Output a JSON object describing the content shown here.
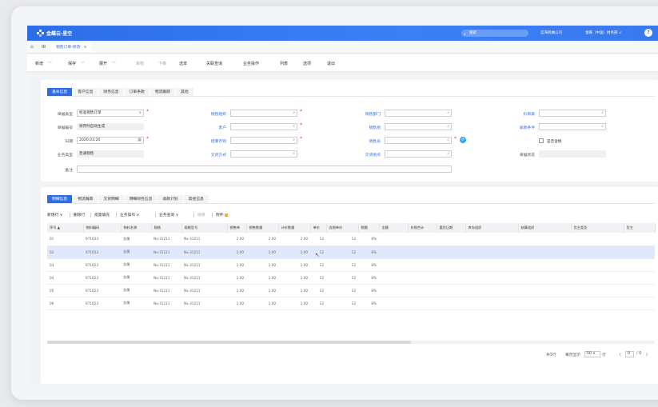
{
  "topbar": {
    "logo": "金蝶云·星空",
    "search_placeholder": "搜索",
    "company": "蓝海机械公司",
    "user": "金蝶（中国）财务部 ∨",
    "help": "?"
  },
  "tab": {
    "title": "销售订单-修改",
    "close": "⊗"
  },
  "toolbar": [
    {
      "label": "新增",
      "chev": true,
      "disabled": false
    },
    {
      "label": "保存",
      "chev": true,
      "disabled": false
    },
    {
      "label": "展开",
      "chev": true,
      "disabled": false
    },
    {
      "label": "审核",
      "chev": false,
      "disabled": true
    },
    {
      "label": "下推",
      "chev": false,
      "disabled": true
    },
    {
      "label": "选单",
      "chev": false,
      "disabled": false
    },
    {
      "label": "关联查询",
      "chev": false,
      "disabled": false
    },
    {
      "label": "业务操作",
      "chev": false,
      "disabled": false
    },
    {
      "label": "列表",
      "chev": false,
      "disabled": false
    },
    {
      "label": "选项",
      "chev": false,
      "disabled": false
    },
    {
      "label": "退出",
      "chev": false,
      "disabled": false
    }
  ],
  "form_tabs": [
    "基本信息",
    "客户信息",
    "财务信息",
    "订单条款",
    "物流跟踪",
    "其他"
  ],
  "form": {
    "bill_type_label": "单据类型",
    "bill_type_value": "标准销售订单",
    "bill_no_label": "单据编号",
    "bill_no_value": "保存时自动生成",
    "date_label": "日期",
    "date_value": "2020.03.20",
    "biz_type_label": "业务类型",
    "biz_type_value": "普通销售",
    "remark_label": "备注",
    "sale_org_label": "销售组织",
    "customer_label": "客户",
    "currency_label": "结算币别",
    "delivery_label": "交货方式",
    "sale_dept_label": "销售部门",
    "sale_group_label": "销售组",
    "salesman_label": "销售员",
    "delivery_place_label": "交货地点",
    "price_list_label": "价目表",
    "payment_label": "收款条件",
    "tax_included_label": "是否含税",
    "status_label": "单据状态"
  },
  "grid_tabs": [
    "明细信息",
    "物流跟踪",
    "交货明细",
    "明细财务信息",
    "收款计划",
    "其他信息"
  ],
  "grid_toolbar": {
    "add_row": "新增行",
    "del_row": "删除行",
    "batch_fill": "批量填充",
    "biz_op": "业务操作",
    "biz_query": "业务查询",
    "bom": "搜单",
    "attach": "附件",
    "attach_count": "0"
  },
  "columns": [
    "序号 ▲",
    "物料编码",
    "物料名称",
    "规格",
    "规格型号",
    "销售单",
    "销售数量",
    "计价数量",
    "单价",
    "含税单价",
    "税额",
    "金额",
    "价税合计",
    "要货日期",
    "库存组织",
    "结算组织",
    "货主类型",
    "货主"
  ],
  "rows": [
    [
      "01",
      "971023",
      "金属",
      "Nx-31211",
      "Nx-31211",
      "2.00",
      "2.00",
      "2.00",
      "12",
      "12",
      "8%"
    ],
    [
      "02",
      "971023",
      "金属",
      "Nx-31211",
      "Nx-31211",
      "2.00",
      "2.00",
      "2.00",
      "12",
      "12",
      "8%"
    ],
    [
      "03",
      "971023",
      "金属",
      "Nx-31211",
      "Nx-31211",
      "2.00",
      "2.00",
      "2.00",
      "12",
      "12",
      "8%"
    ],
    [
      "04",
      "971023",
      "金属",
      "Nx-31211",
      "Nx-31211",
      "2.00",
      "2.00",
      "2.00",
      "12",
      "12",
      "8%"
    ],
    [
      "05",
      "971023",
      "金属",
      "Nx-31211",
      "Nx-31211",
      "2.00",
      "2.00",
      "2.00",
      "12",
      "12",
      "8%"
    ],
    [
      "06",
      "971023",
      "金属",
      "Nx-31211",
      "Nx-31211",
      "2.00",
      "2.00",
      "2.00",
      "12",
      "12",
      "8%"
    ]
  ],
  "selected_row": 1,
  "pager": {
    "total": "共3行",
    "per_page_label": "每页显示",
    "per_page": "50 ∨",
    "unit": "行",
    "page": "0",
    "of": "/ 0"
  },
  "colors": {
    "primary": "#2d6ee8",
    "selected_row": "#dfe9fb",
    "required": "#e33333"
  }
}
